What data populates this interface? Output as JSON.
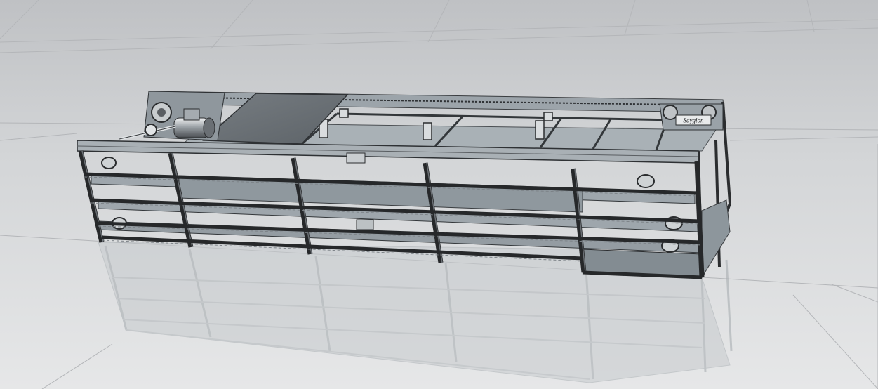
{
  "viewport": {
    "background_top": "#bfc1c4",
    "background_bottom": "#e4e5e6",
    "grid_color": "#b4b6b9",
    "frame_color": "#2b2d2f",
    "frame_light": "#5a5e62",
    "plate_color": "#6b7176",
    "panel_color": "#98a1a7",
    "reflection_color": "#b7bcbf"
  },
  "model": {
    "label_plate_text": "Saygion",
    "icon": "cad-assembly-icon"
  }
}
